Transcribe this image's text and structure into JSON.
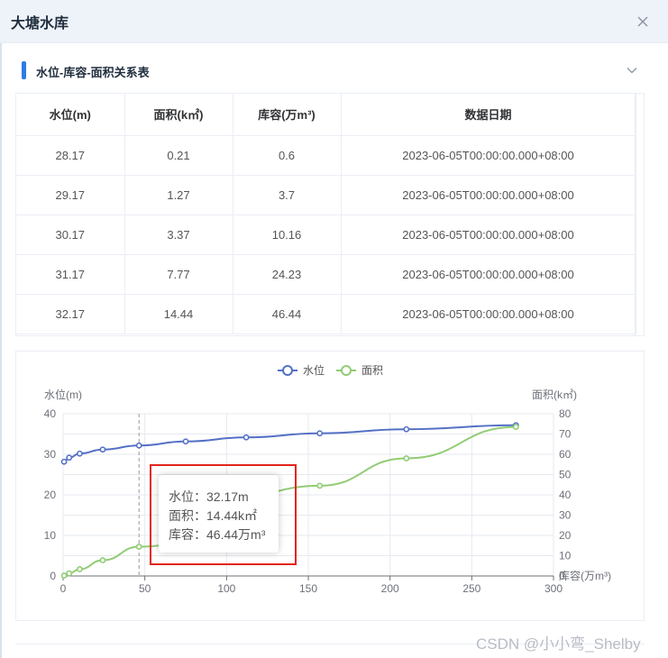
{
  "dialog": {
    "title": "大塘水库",
    "close_icon": "close-icon"
  },
  "section": {
    "title": "水位-库容-面积关系表",
    "accent": "#2d7be5",
    "toggle_icon": "chevron-down-icon"
  },
  "table": {
    "headers": [
      "水位(m)",
      "面积(k㎡)",
      "库容(万m³)",
      "数据日期"
    ],
    "rows": [
      [
        "28.17",
        "0.21",
        "0.6",
        "2023-06-05T00:00:00.000+08:00"
      ],
      [
        "29.17",
        "1.27",
        "3.7",
        "2023-06-05T00:00:00.000+08:00"
      ],
      [
        "30.17",
        "3.37",
        "10.16",
        "2023-06-05T00:00:00.000+08:00"
      ],
      [
        "31.17",
        "7.77",
        "24.23",
        "2023-06-05T00:00:00.000+08:00"
      ],
      [
        "32.17",
        "14.44",
        "46.44",
        "2023-06-05T00:00:00.000+08:00"
      ]
    ]
  },
  "chart_data": {
    "type": "line",
    "legend": [
      "水位",
      "面积"
    ],
    "legend_position": "top-center",
    "y_left_label": "水位(m)",
    "y_right_label": "面积(k㎡)",
    "x_label": "库容(万m³)",
    "xlim": [
      0,
      300
    ],
    "ylim_left": [
      0,
      40
    ],
    "ylim_right": [
      0,
      80
    ],
    "x_ticks": [
      "0",
      "50",
      "100",
      "150",
      "200",
      "250",
      "300"
    ],
    "y_left_ticks": [
      "0",
      "10",
      "20",
      "30",
      "40"
    ],
    "y_right_ticks": [
      "0",
      "10",
      "20",
      "30",
      "40",
      "50",
      "60",
      "70",
      "80"
    ],
    "grid": true,
    "series": [
      {
        "name": "水位",
        "axis": "left",
        "color": "#5470c6",
        "x": [
          0.6,
          3.7,
          10.16,
          24.23,
          46.44,
          75,
          112,
          157,
          210,
          277
        ],
        "y": [
          28.17,
          29.17,
          30.17,
          31.17,
          32.17,
          33.17,
          34.17,
          35.17,
          36.17,
          37.17
        ]
      },
      {
        "name": "面积",
        "axis": "right",
        "color": "#91cc75",
        "x": [
          0.6,
          3.7,
          10.16,
          24.23,
          46.44,
          157,
          210,
          277
        ],
        "y": [
          0.21,
          1.27,
          3.37,
          7.77,
          14.44,
          44.5,
          58,
          73.5
        ]
      }
    ],
    "pointer_x": 46.44
  },
  "tooltip": {
    "lines": [
      "水位：32.17m",
      "面积：14.44k㎡",
      "库容：46.44万m³"
    ]
  },
  "watermark": "CSDN @小小弯_Shelby"
}
